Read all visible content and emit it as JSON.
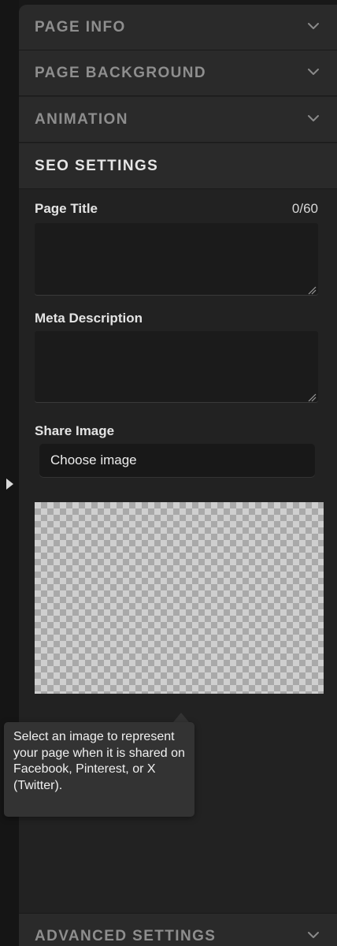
{
  "sections": {
    "page_info": {
      "title": "PAGE INFO"
    },
    "page_background": {
      "title": "PAGE BACKGROUND"
    },
    "animation": {
      "title": "ANIMATION"
    },
    "seo_settings": {
      "title": "SEO SETTINGS"
    },
    "advanced_settings": {
      "title": "ADVANCED SETTINGS"
    }
  },
  "seo": {
    "page_title_label": "Page Title",
    "page_title_counter": "0/60",
    "page_title_value": "",
    "meta_description_label": "Meta Description",
    "meta_description_value": "",
    "share_image_label": "Share Image",
    "choose_image_label": "Choose image",
    "tooltip_text": "Select an image to represent your page when it is shared on Facebook, Pinterest, or X (Twitter)."
  },
  "icons": {
    "collapse_chevron": "chevron-down-icon",
    "resize_handle": "resize-grip-icon",
    "expand_toggle": "caret-right-icon"
  },
  "colors": {
    "panel_bg": "#222222",
    "header_bg": "#2a2a2a",
    "header_text_collapsed": "#8e8e8e",
    "header_text_open": "#e6e6e6",
    "tooltip_bg": "#333333"
  }
}
